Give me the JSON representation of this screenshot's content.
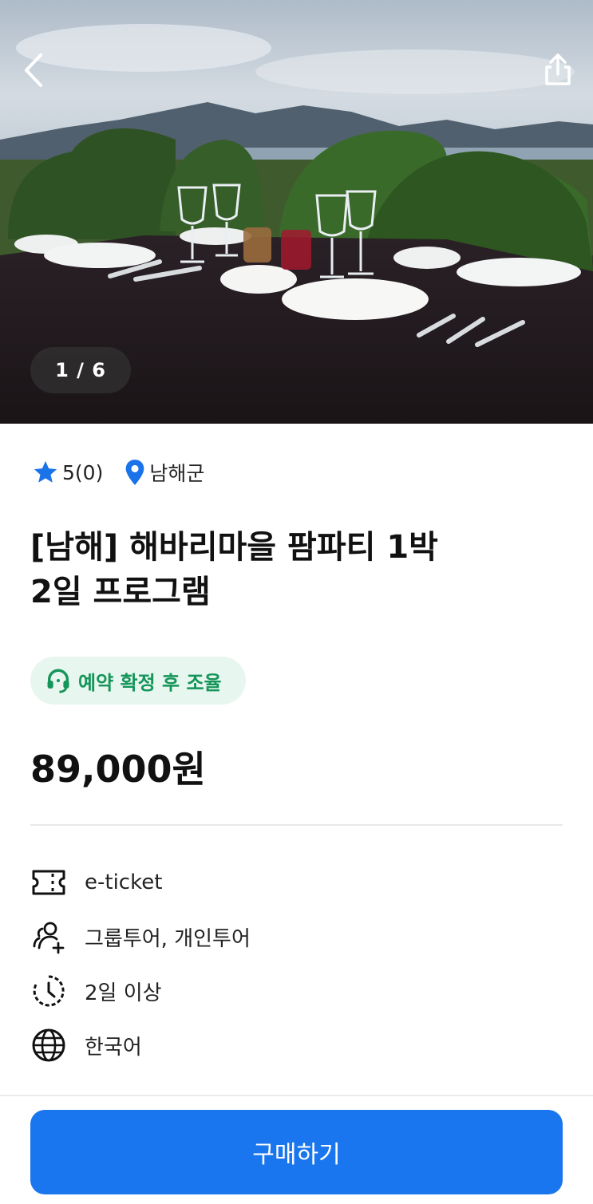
{
  "hero": {
    "image_alt": "topiary garden dining table",
    "counter": "1 / 6",
    "back_icon": "chevron-left-icon",
    "share_icon": "share-icon"
  },
  "meta": {
    "rating": "5(0)",
    "location": "남해군",
    "star_color": "#1a73e8",
    "pin_color": "#1a73e8"
  },
  "title": {
    "line1": "[남해] 해바리마을 팜파티 1박",
    "line2": "2일 프로그램"
  },
  "badge": {
    "label": "예약 확정 후 조율",
    "color": "#14955a",
    "background": "#e7f6ee"
  },
  "price": "89,000원",
  "info": [
    {
      "icon": "ticket-icon",
      "label": "e-ticket"
    },
    {
      "icon": "group-icon",
      "label": "그룹투어, 개인투어"
    },
    {
      "icon": "clock-icon",
      "label": "2일 이상"
    },
    {
      "icon": "globe-icon",
      "label": "한국어"
    }
  ],
  "bottom": {
    "buy_label": "구매하기",
    "button_color": "#1976ee"
  }
}
